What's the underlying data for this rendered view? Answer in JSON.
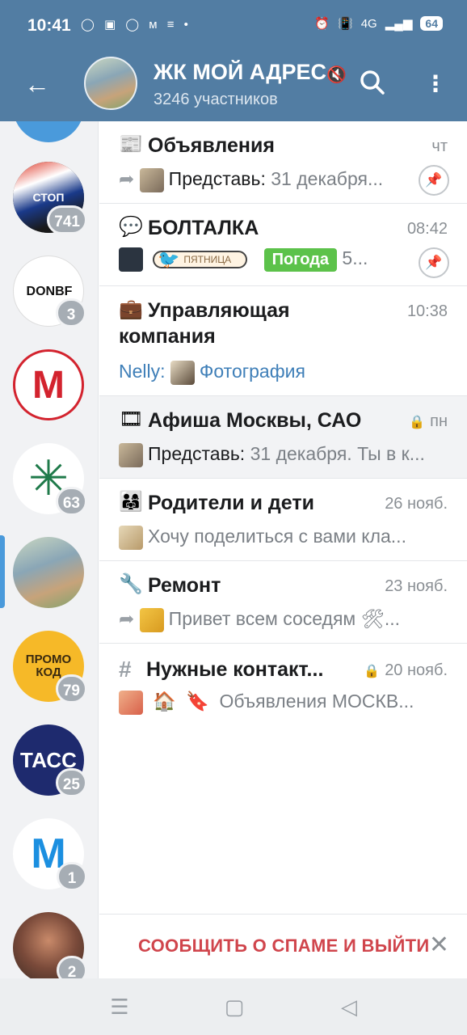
{
  "status_bar": {
    "time": "10:41",
    "left_icons": "◯ ▣ ◯ м ≡ •",
    "network": "4G",
    "battery": "64"
  },
  "header": {
    "title": "ЖК МОЙ АДРЕС",
    "subtitle": "3246 участников"
  },
  "sidebar": {
    "items": [
      {
        "badge": "",
        "color": "#4a9adb"
      },
      {
        "badge": "741",
        "color": "#1a1a1a",
        "label": "СТОП"
      },
      {
        "badge": "3",
        "color": "#ffffff",
        "label": "DONBF"
      },
      {
        "badge": "",
        "color": "#ffffff",
        "label": "М"
      },
      {
        "badge": "63",
        "color": "#ffffff",
        "label": "✳"
      },
      {
        "badge": "",
        "color": "#a7b9a0",
        "label": ""
      },
      {
        "badge": "79",
        "color": "#f6b928",
        "label": "ПРОМО КОД"
      },
      {
        "badge": "25",
        "color": "#1e2a6e",
        "label": "ТАСС"
      },
      {
        "badge": "1",
        "color": "#ffffff",
        "label": "M"
      },
      {
        "badge": "2",
        "color": "#7a4a3a",
        "label": ""
      }
    ]
  },
  "topics": [
    {
      "icon": "📰",
      "name": "Объявления",
      "date": "чт",
      "sender": "Представь:",
      "text": " 31 декабря...",
      "pinned": true
    },
    {
      "icon": "💬",
      "name": "БОЛТАЛКА",
      "date": "08:42",
      "pill": "ПЯТНИЦА",
      "tag": "Погода",
      "tag_tail": "5...",
      "pinned": true
    },
    {
      "icon": "💼",
      "name_line1": "Управляющая",
      "name_line2": "компания",
      "date": "10:38",
      "sender": "Nelly:",
      "text": "Фотография"
    },
    {
      "icon": "🎞",
      "name": "Афиша Москвы, САО",
      "date": "пн",
      "sender": "Представь:",
      "text": " 31 декабря. Ты в к..."
    },
    {
      "icon": "👨‍👩‍👧",
      "name": "Родители и дети",
      "date": "26 нояб.",
      "text": "Хочу поделиться с вами кла..."
    },
    {
      "icon": "🔧",
      "name": "Ремонт",
      "date": "23 нояб.",
      "text": "Привет всем соседям 🛠..."
    },
    {
      "icon": "#",
      "name": "Нужные контакт...",
      "date": "20 нояб.",
      "text": "Объявления МОСКВ..."
    }
  ],
  "spam": {
    "label": "СООБЩИТЬ О СПАМЕ И ВЫЙТИ"
  },
  "colors": {
    "header": "#527da3",
    "accent": "#4a9adb",
    "spam": "#d0454c"
  }
}
